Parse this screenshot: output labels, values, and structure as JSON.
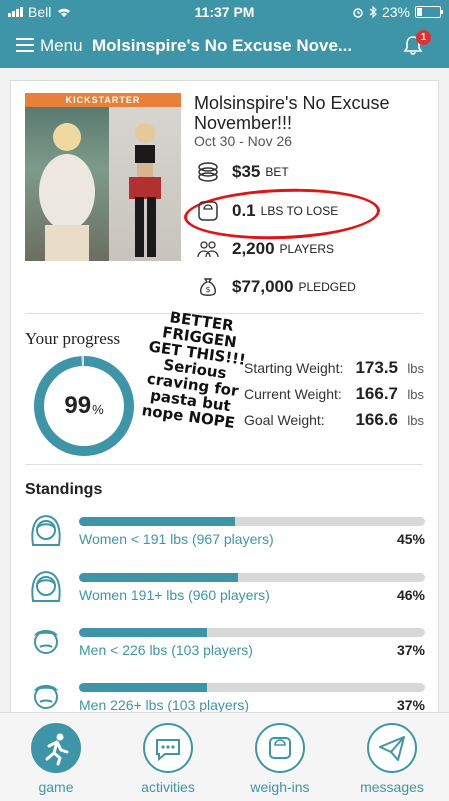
{
  "status_bar": {
    "carrier": "Bell",
    "time": "11:37 PM",
    "battery_text": "23%",
    "battery_level": 0.23
  },
  "header": {
    "menu_label": "Menu",
    "title": "Molsinspire's No Excuse Nove...",
    "notification_count": "1"
  },
  "game": {
    "banner": "KICKSTARTER",
    "title": "Molsinspire's No Excuse November!!!",
    "dates": "Oct 30 - Nov 26",
    "bet_value": "$35",
    "bet_label": "BET",
    "to_lose_value": "0.1",
    "to_lose_label": "LBS TO LOSE",
    "players_value": "2,200",
    "players_label": "PLAYERS",
    "pledged_value": "$77,000",
    "pledged_label": "PLEDGED"
  },
  "progress": {
    "label": "Your progress",
    "percent": "99",
    "percent_sign": "%",
    "fraction": 0.99,
    "starting_label": "Starting Weight:",
    "starting_value": "173.5",
    "current_label": "Current Weight:",
    "current_value": "166.7",
    "goal_label": "Goal Weight:",
    "goal_value": "166.6",
    "unit": "lbs"
  },
  "scrawl": {
    "line1": "BETTER",
    "line2": "FRIGGEN",
    "line3": "GET THIS!!!",
    "line4": "Serious",
    "line5": "craving for",
    "line6": "pasta but",
    "line7": "nope NOPE"
  },
  "standings": {
    "label": "Standings",
    "items": [
      {
        "label": "Women < 191 lbs (967 players)",
        "percent": "45%",
        "fraction": 0.45
      },
      {
        "label": "Women 191+ lbs (960 players)",
        "percent": "46%",
        "fraction": 0.46
      },
      {
        "label": "Men < 226 lbs (103 players)",
        "percent": "37%",
        "fraction": 0.37
      },
      {
        "label": "Men 226+ lbs (103 players)",
        "percent": "37%",
        "fraction": 0.37
      }
    ]
  },
  "tabs": {
    "game": "game",
    "activities": "activities",
    "weighins": "weigh-ins",
    "messages": "messages"
  },
  "colors": {
    "accent": "#3e95a8",
    "annotation_red": "#e01414",
    "banner_orange": "#e8803a"
  }
}
